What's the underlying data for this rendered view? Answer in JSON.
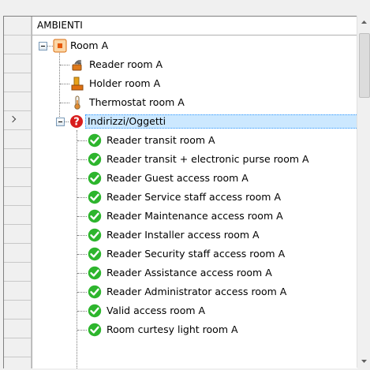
{
  "header": {
    "title": "AMBIENTI"
  },
  "tree": {
    "root": {
      "label": "Room A",
      "expanded": true
    },
    "devices": [
      {
        "label": "Reader room A",
        "icon": "reader-icon"
      },
      {
        "label": "Holder room A",
        "icon": "holder-icon"
      },
      {
        "label": "Thermostat room A",
        "icon": "thermostat-icon"
      }
    ],
    "group": {
      "label": "Indirizzi/Oggetti",
      "expanded": true,
      "selected": true,
      "icon": "question-icon"
    },
    "items": [
      {
        "label": "Reader transit room A",
        "icon": "check-icon"
      },
      {
        "label": "Reader transit + electronic purse room A",
        "icon": "check-icon"
      },
      {
        "label": "Reader Guest access room A",
        "icon": "check-icon"
      },
      {
        "label": "Reader Service staff access room A",
        "icon": "check-icon"
      },
      {
        "label": "Reader Maintenance access room A",
        "icon": "check-icon"
      },
      {
        "label": "Reader Installer access room A",
        "icon": "check-icon"
      },
      {
        "label": "Reader Security staff access room A",
        "icon": "check-icon"
      },
      {
        "label": "Reader Assistance access room A",
        "icon": "check-icon"
      },
      {
        "label": "Reader Administrator access room A",
        "icon": "check-icon"
      },
      {
        "label": "Valid access room A",
        "icon": "check-icon"
      },
      {
        "label": "Room curtesy light room A",
        "icon": "check-icon"
      }
    ]
  },
  "colors": {
    "selection": "#cce8ff",
    "check": "#2db52d",
    "question": "#d81e1e",
    "room": "#f08a24"
  }
}
